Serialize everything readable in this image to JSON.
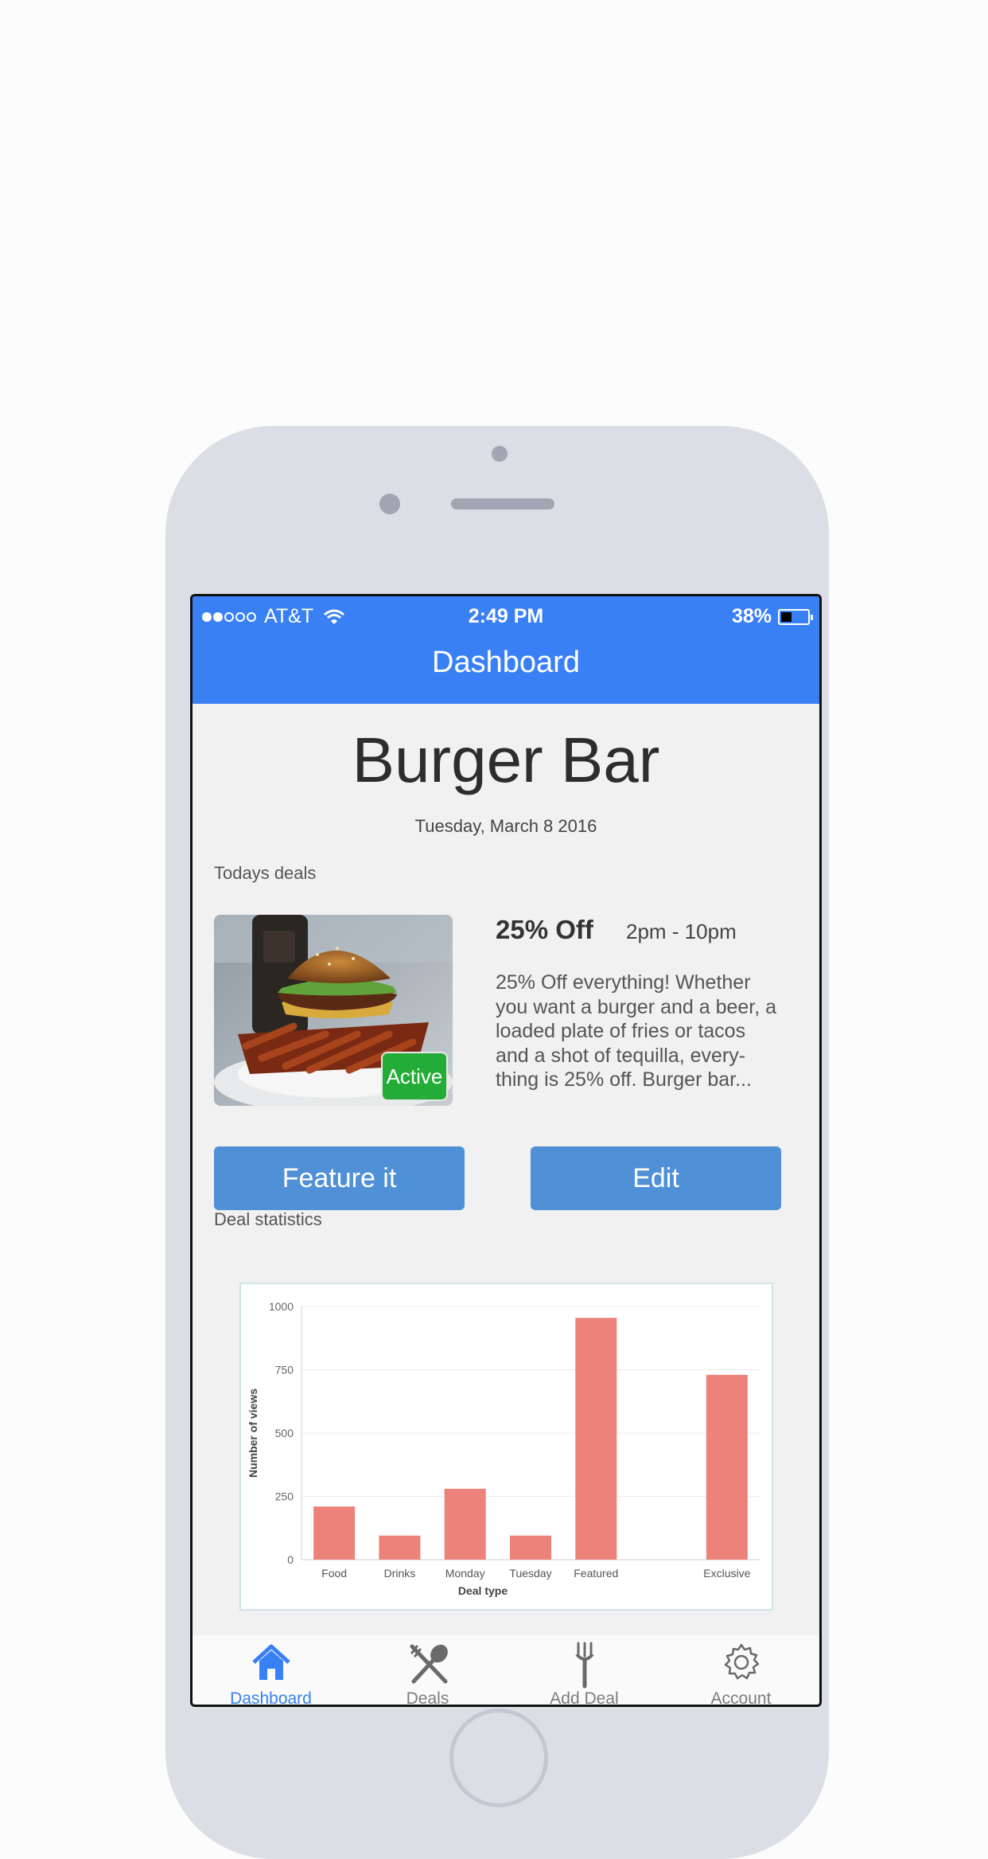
{
  "status_bar": {
    "carrier": "AT&T",
    "time": "2:49 PM",
    "battery": "38%"
  },
  "header": {
    "title": "Dashboard"
  },
  "business": {
    "name": "Burger Bar",
    "date": "Tuesday, March 8 2016"
  },
  "todays_deals": {
    "label": "Todays deals",
    "deal": {
      "title": "25% Off",
      "hours": "2pm - 10pm",
      "description": "25% Off everything! Whether you want a burger and a beer, a loaded plate of fries or tacos and a shot of tequilla, every-thing is 25% off.  Burger bar...",
      "status": "Active",
      "status_color": "#23ad38"
    }
  },
  "buttons": {
    "feature": "Feature it",
    "edit": "Edit"
  },
  "statistics": {
    "label": "Deal statistics"
  },
  "chart_data": {
    "type": "bar",
    "categories": [
      "Food",
      "Drinks",
      "Monday",
      "Tuesday",
      "Featured",
      "",
      "Exclusive"
    ],
    "values": [
      210,
      95,
      280,
      95,
      955,
      null,
      730
    ],
    "xlabel": "Deal type",
    "ylabel": "Number of views",
    "ylim": [
      0,
      1000
    ],
    "yticks": [
      0,
      250,
      500,
      750,
      1000
    ],
    "bar_color": "#ec8279",
    "grid": true
  },
  "tabbar": {
    "items": [
      {
        "label": "Dashboard",
        "icon": "home-icon",
        "active": true
      },
      {
        "label": "Deals",
        "icon": "fork-spoon-icon",
        "active": false
      },
      {
        "label": "Add Deal",
        "icon": "fork-icon",
        "active": false
      },
      {
        "label": "Account",
        "icon": "gear-icon",
        "active": false
      }
    ]
  },
  "colors": {
    "accent": "#3a80f5",
    "button": "#5090d6",
    "phone_frame": "#dcdee6"
  }
}
